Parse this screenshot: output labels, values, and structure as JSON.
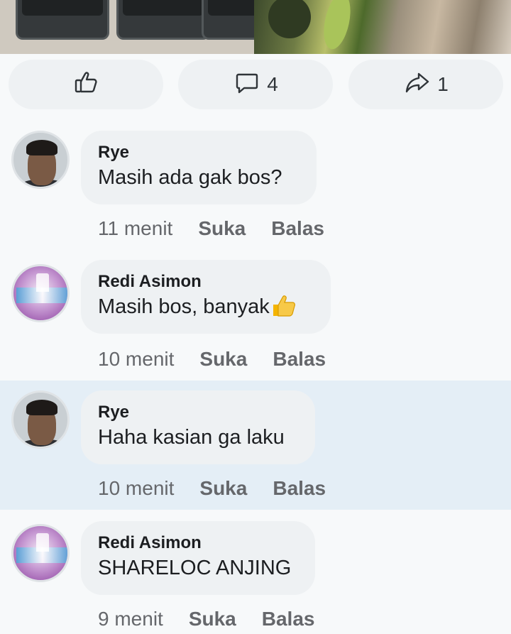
{
  "actions": {
    "like_icon": "thumbs-up-icon",
    "comment_icon": "comment-icon",
    "comment_count": "4",
    "share_icon": "share-icon",
    "share_count": "1"
  },
  "comments": [
    {
      "author": "Rye",
      "text": "Masih ada gak bos?",
      "time": "11 menit",
      "like_label": "Suka",
      "reply_label": "Balas"
    },
    {
      "author": "Redi Asimon",
      "text": "Masih bos, banyak",
      "emoji": "thumbs-up-emoji",
      "time": "10 menit",
      "like_label": "Suka",
      "reply_label": "Balas"
    },
    {
      "author": "Rye",
      "text": "Haha kasian ga laku",
      "time": "10 menit",
      "like_label": "Suka",
      "reply_label": "Balas"
    },
    {
      "author": "Redi Asimon",
      "text": "SHARELOC ANJING",
      "time": "9 menit",
      "like_label": "Suka",
      "reply_label": "Balas"
    }
  ],
  "colors": {
    "background": "#f7f9fa",
    "bubble": "#eef1f3",
    "highlight": "#e4eef6",
    "meta_text": "#65676b"
  }
}
